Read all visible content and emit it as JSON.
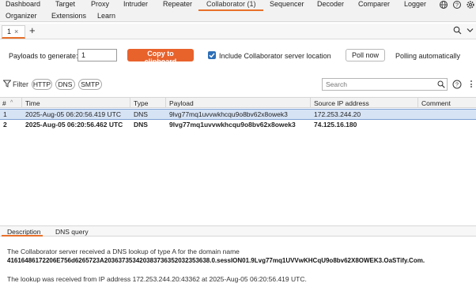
{
  "nav": {
    "row1": [
      "Dashboard",
      "Target",
      "Proxy",
      "Intruder",
      "Repeater",
      "Collaborator (1)",
      "Sequencer",
      "Decoder",
      "Comparer",
      "Logger"
    ],
    "row2": [
      "Organizer",
      "Extensions",
      "Learn"
    ],
    "icons": [
      "globe-icon",
      "help-icon",
      "settings-icon"
    ]
  },
  "subtabs": {
    "tab_label": "1",
    "close": "×",
    "add": "+"
  },
  "controls": {
    "payloads_label": "Payloads to generate:",
    "payloads_value": "1",
    "copy_button": "Copy to clipboard",
    "include_checked": true,
    "include_label": "Include Collaborator server location",
    "poll_button": "Poll now",
    "polling_status": "Polling automatically"
  },
  "filter": {
    "label": "Filter",
    "pills": [
      "HTTP",
      "DNS",
      "SMTP"
    ],
    "search_placeholder": "Search"
  },
  "table": {
    "headers": [
      "#",
      "Time",
      "Type",
      "Payload",
      "Source IP address",
      "Comment"
    ],
    "sort_indicator": "^",
    "rows": [
      {
        "num": "1",
        "time": "2025-Aug-05 06:20:56.419 UTC",
        "type": "DNS",
        "payload": "9lvg77mq1uvvwkhcqu9o8bv62x8owek3",
        "ip": "172.253.244.20",
        "comment": "",
        "selected": true,
        "bold": false
      },
      {
        "num": "2",
        "time": "2025-Aug-05 06:20:56.462 UTC",
        "type": "DNS",
        "payload": "9lvg77mq1uvvwkhcqu9o8bv62x8owek3",
        "ip": "74.125.16.180",
        "comment": "",
        "selected": false,
        "bold": true
      }
    ]
  },
  "details": {
    "tabs": [
      "Description",
      "DNS query"
    ],
    "line1": "The Collaborator server received a DNS lookup of type A for the domain name",
    "line2": "41616486172206E756d6265723A20363735342038373635203235363​8.0.sessION01.9Lvg77mq1UVVwKHCqU9o8bv62X8OWEK3.OaSTify.Com.",
    "line3": "The lookup was received from IP address 172.253.244.20:43362 at 2025-Aug-05 06:20:56.419 UTC."
  }
}
